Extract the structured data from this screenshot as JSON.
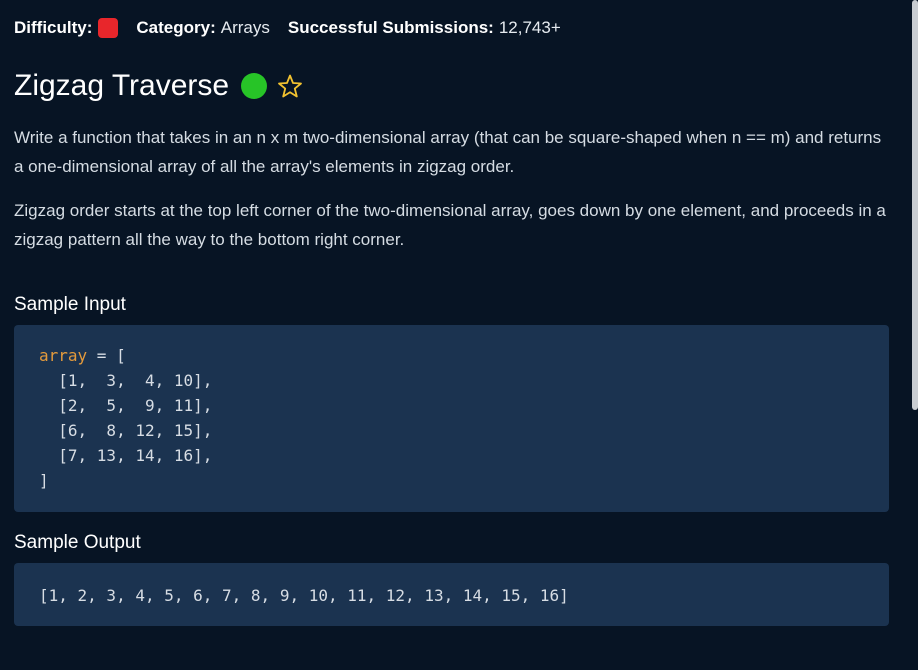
{
  "meta": {
    "difficulty_label": "Difficulty:",
    "difficulty_color": "#e8262b",
    "category_label": "Category:",
    "category_value": "Arrays",
    "submissions_label": "Successful Submissions:",
    "submissions_value": "12,743+"
  },
  "question": {
    "title": "Zigzag Traverse",
    "status_color": "#27c427",
    "favorite_icon": "star-outline-icon",
    "description": [
      "Write a function that takes in an n x m two-dimensional array (that can be square-shaped when n == m) and returns a one-dimensional array of all the array's elements in zigzag order.",
      "Zigzag order starts at the top left corner of the two-dimensional array, goes down by one element, and proceeds in a zigzag pattern all the way to the bottom right corner."
    ]
  },
  "sample_input": {
    "heading": "Sample Input",
    "var_name": "array",
    "assign": " = [",
    "rows": [
      "  [1,  3,  4, 10],",
      "  [2,  5,  9, 11],",
      "  [6,  8, 12, 15],",
      "  [7, 13, 14, 16],"
    ],
    "close": "]"
  },
  "sample_output": {
    "heading": "Sample Output",
    "value": "[1, 2, 3, 4, 5, 6, 7, 8, 9, 10, 11, 12, 13, 14, 15, 16]"
  },
  "colors": {
    "background": "#071424",
    "code_background": "#1b3350",
    "code_variable": "#e39a3c"
  }
}
